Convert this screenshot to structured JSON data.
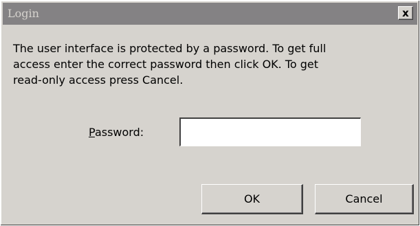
{
  "window": {
    "title": "Login",
    "close_glyph": "x"
  },
  "message": "The user interface is protected by a password.  To get full\naccess enter the correct password then click OK.  To get\nread-only access press Cancel.",
  "password": {
    "label_mnemonic": "P",
    "label_rest": "assword:",
    "value": "",
    "placeholder": ""
  },
  "buttons": {
    "ok_label": "OK",
    "cancel_label": "Cancel"
  },
  "colors": {
    "dialog_face": "#d6d3ce",
    "titlebar_inactive": "#848284",
    "title_text": "#d6d3ce"
  }
}
